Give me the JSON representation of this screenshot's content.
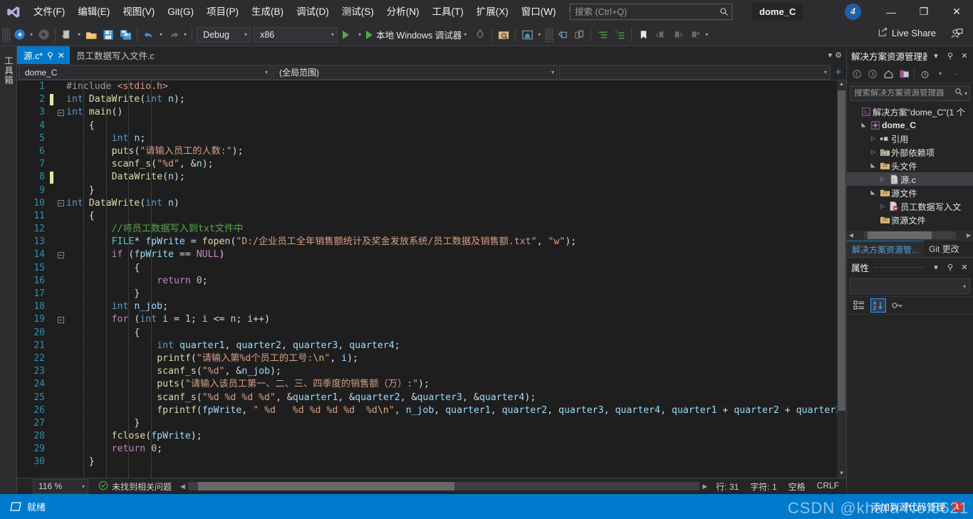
{
  "titlebar": {
    "logo_icon": "visual-studio-logo",
    "menus": [
      {
        "label": "文件(F)"
      },
      {
        "label": "编辑(E)"
      },
      {
        "label": "视图(V)"
      },
      {
        "label": "Git(G)"
      },
      {
        "label": "项目(P)"
      },
      {
        "label": "生成(B)"
      },
      {
        "label": "调试(D)"
      },
      {
        "label": "测试(S)"
      },
      {
        "label": "分析(N)"
      },
      {
        "label": "工具(T)"
      },
      {
        "label": "扩展(X)"
      },
      {
        "label": "窗口(W)"
      },
      {
        "label": "帮助(H)"
      }
    ],
    "search_placeholder": "搜索 (Ctrl+Q)",
    "search_value": "",
    "solution_name": "dome_C",
    "badge_count": "4",
    "minimize": "—",
    "restore": "❐",
    "close": "✕"
  },
  "toolbar": {
    "back_icon": "navigate-back-icon",
    "forward_icon": "navigate-forward-icon",
    "new_item_icon": "new-file-icon",
    "open_icon": "open-folder-icon",
    "save_icon": "save-icon",
    "save_all_icon": "save-all-icon",
    "undo_icon": "undo-icon",
    "redo_icon": "redo-icon",
    "config_value": "Debug",
    "platform_value": "x86",
    "start_label": "本地 Windows 调试器",
    "hot_reload_icon": "hot-reload-icon",
    "find_in_files_icon": "find-in-files-icon",
    "home_icon": "home-icon",
    "bookmark_icon": "bookmark-icon",
    "live_share_label": "Live Share",
    "account_icon": "account-icon"
  },
  "tabs": [
    {
      "label": "源.c*",
      "active": true,
      "pin_icon": "pin-icon",
      "close_icon": "close-icon"
    },
    {
      "label": "员工数据写入文件.c",
      "active": false
    }
  ],
  "navbar": {
    "project": "dome_C",
    "scope": "(全局范围)",
    "member": ""
  },
  "editor": {
    "lines": [
      {
        "n": "1",
        "changed": false,
        "fold": "",
        "indent": 0,
        "tokens": [
          {
            "t": "#include ",
            "c": "pp"
          },
          {
            "t": "<stdio.h>",
            "c": "st"
          }
        ]
      },
      {
        "n": "2",
        "changed": true,
        "fold": "",
        "indent": 0,
        "tokens": [
          {
            "t": "int",
            "c": "k"
          },
          {
            "t": " ",
            "c": "pn"
          },
          {
            "t": "DataWrite",
            "c": "fn"
          },
          {
            "t": "(",
            "c": "pn"
          },
          {
            "t": "int",
            "c": "k"
          },
          {
            "t": " n",
            "c": "id"
          },
          {
            "t": ");",
            "c": "pn"
          }
        ]
      },
      {
        "n": "3",
        "changed": false,
        "fold": "-",
        "indent": 0,
        "tokens": [
          {
            "t": "int",
            "c": "k"
          },
          {
            "t": " ",
            "c": "pn"
          },
          {
            "t": "main",
            "c": "fn"
          },
          {
            "t": "()",
            "c": "pn"
          }
        ]
      },
      {
        "n": "4",
        "changed": false,
        "fold": "",
        "indent": 1,
        "tokens": [
          {
            "t": "{",
            "c": "pn"
          }
        ]
      },
      {
        "n": "5",
        "changed": false,
        "fold": "",
        "indent": 2,
        "tokens": [
          {
            "t": "int",
            "c": "k"
          },
          {
            "t": " ",
            "c": "pn"
          },
          {
            "t": "n",
            "c": "id"
          },
          {
            "t": ";",
            "c": "pn"
          }
        ]
      },
      {
        "n": "6",
        "changed": false,
        "fold": "",
        "indent": 2,
        "tokens": [
          {
            "t": "puts",
            "c": "fn"
          },
          {
            "t": "(",
            "c": "pn"
          },
          {
            "t": "\"请输入员工的人数:\"",
            "c": "st"
          },
          {
            "t": ");",
            "c": "pn"
          }
        ]
      },
      {
        "n": "7",
        "changed": false,
        "fold": "",
        "indent": 2,
        "tokens": [
          {
            "t": "scanf_s",
            "c": "fn"
          },
          {
            "t": "(",
            "c": "pn"
          },
          {
            "t": "\"%d\"",
            "c": "st"
          },
          {
            "t": ", &",
            "c": "pn"
          },
          {
            "t": "n",
            "c": "id"
          },
          {
            "t": ");",
            "c": "pn"
          }
        ]
      },
      {
        "n": "8",
        "changed": true,
        "fold": "",
        "indent": 2,
        "tokens": [
          {
            "t": "DataWrite",
            "c": "fn"
          },
          {
            "t": "(",
            "c": "pn"
          },
          {
            "t": "n",
            "c": "id"
          },
          {
            "t": ");",
            "c": "pn"
          }
        ]
      },
      {
        "n": "9",
        "changed": false,
        "fold": "",
        "indent": 1,
        "tokens": [
          {
            "t": "}",
            "c": "pn"
          }
        ]
      },
      {
        "n": "10",
        "changed": false,
        "fold": "-",
        "indent": 0,
        "tokens": [
          {
            "t": "int",
            "c": "k"
          },
          {
            "t": " ",
            "c": "pn"
          },
          {
            "t": "DataWrite",
            "c": "fn"
          },
          {
            "t": "(",
            "c": "pn"
          },
          {
            "t": "int",
            "c": "k"
          },
          {
            "t": " n",
            "c": "id"
          },
          {
            "t": ")",
            "c": "pn"
          }
        ]
      },
      {
        "n": "11",
        "changed": false,
        "fold": "",
        "indent": 1,
        "tokens": [
          {
            "t": "{",
            "c": "pn"
          }
        ]
      },
      {
        "n": "12",
        "changed": false,
        "fold": "",
        "indent": 2,
        "tokens": [
          {
            "t": "//将员工数据写入到txt文件中",
            "c": "cm"
          }
        ]
      },
      {
        "n": "13",
        "changed": false,
        "fold": "",
        "indent": 2,
        "tokens": [
          {
            "t": "FILE",
            "c": "ty"
          },
          {
            "t": "* ",
            "c": "pn"
          },
          {
            "t": "fpWrite",
            "c": "id"
          },
          {
            "t": " = ",
            "c": "pn"
          },
          {
            "t": "fopen",
            "c": "fn"
          },
          {
            "t": "(",
            "c": "pn"
          },
          {
            "t": "\"D:/企业员工全年销售额统计及奖金发放系统/员工数据及销售额.txt\"",
            "c": "st"
          },
          {
            "t": ", ",
            "c": "pn"
          },
          {
            "t": "\"w\"",
            "c": "st"
          },
          {
            "t": ");",
            "c": "pn"
          }
        ]
      },
      {
        "n": "14",
        "changed": false,
        "fold": "-",
        "indent": 2,
        "tokens": [
          {
            "t": "if",
            "c": "kc"
          },
          {
            "t": " (",
            "c": "pn"
          },
          {
            "t": "fpWrite",
            "c": "id"
          },
          {
            "t": " == ",
            "c": "pn"
          },
          {
            "t": "NULL",
            "c": "kc"
          },
          {
            "t": ")",
            "c": "pn"
          }
        ]
      },
      {
        "n": "15",
        "changed": false,
        "fold": "",
        "indent": 3,
        "tokens": [
          {
            "t": "{",
            "c": "pn"
          }
        ]
      },
      {
        "n": "16",
        "changed": false,
        "fold": "",
        "indent": 4,
        "tokens": [
          {
            "t": "return",
            "c": "kc"
          },
          {
            "t": " ",
            "c": "pn"
          },
          {
            "t": "0",
            "c": "nu"
          },
          {
            "t": ";",
            "c": "pn"
          }
        ]
      },
      {
        "n": "17",
        "changed": false,
        "fold": "",
        "indent": 3,
        "tokens": [
          {
            "t": "}",
            "c": "pn"
          }
        ]
      },
      {
        "n": "18",
        "changed": false,
        "fold": "",
        "indent": 2,
        "tokens": [
          {
            "t": "int",
            "c": "k"
          },
          {
            "t": " ",
            "c": "pn"
          },
          {
            "t": "n_job",
            "c": "id"
          },
          {
            "t": ";",
            "c": "pn"
          }
        ]
      },
      {
        "n": "19",
        "changed": false,
        "fold": "-",
        "indent": 2,
        "tokens": [
          {
            "t": "for",
            "c": "kc"
          },
          {
            "t": " (",
            "c": "pn"
          },
          {
            "t": "int",
            "c": "k"
          },
          {
            "t": " ",
            "c": "pn"
          },
          {
            "t": "i",
            "c": "id"
          },
          {
            "t": " = ",
            "c": "pn"
          },
          {
            "t": "1",
            "c": "nu"
          },
          {
            "t": "; ",
            "c": "pn"
          },
          {
            "t": "i",
            "c": "id"
          },
          {
            "t": " <= ",
            "c": "pn"
          },
          {
            "t": "n",
            "c": "id"
          },
          {
            "t": "; ",
            "c": "pn"
          },
          {
            "t": "i",
            "c": "id"
          },
          {
            "t": "++)",
            "c": "pn"
          }
        ]
      },
      {
        "n": "20",
        "changed": false,
        "fold": "",
        "indent": 3,
        "tokens": [
          {
            "t": "{",
            "c": "pn"
          }
        ]
      },
      {
        "n": "21",
        "changed": false,
        "fold": "",
        "indent": 4,
        "tokens": [
          {
            "t": "int",
            "c": "k"
          },
          {
            "t": " ",
            "c": "pn"
          },
          {
            "t": "quarter1",
            "c": "id"
          },
          {
            "t": ", ",
            "c": "pn"
          },
          {
            "t": "quarter2",
            "c": "id"
          },
          {
            "t": ", ",
            "c": "pn"
          },
          {
            "t": "quarter3",
            "c": "id"
          },
          {
            "t": ", ",
            "c": "pn"
          },
          {
            "t": "quarter4",
            "c": "id"
          },
          {
            "t": ";",
            "c": "pn"
          }
        ]
      },
      {
        "n": "22",
        "changed": false,
        "fold": "",
        "indent": 4,
        "tokens": [
          {
            "t": "printf",
            "c": "fn"
          },
          {
            "t": "(",
            "c": "pn"
          },
          {
            "t": "\"请输入第%d个员工的工号:",
            "c": "st"
          },
          {
            "t": "\\n",
            "c": "esc"
          },
          {
            "t": "\"",
            "c": "st"
          },
          {
            "t": ", ",
            "c": "pn"
          },
          {
            "t": "i",
            "c": "id"
          },
          {
            "t": ");",
            "c": "pn"
          }
        ]
      },
      {
        "n": "23",
        "changed": false,
        "fold": "",
        "indent": 4,
        "tokens": [
          {
            "t": "scanf_s",
            "c": "fn"
          },
          {
            "t": "(",
            "c": "pn"
          },
          {
            "t": "\"%d\"",
            "c": "st"
          },
          {
            "t": ", &",
            "c": "pn"
          },
          {
            "t": "n_job",
            "c": "id"
          },
          {
            "t": ");",
            "c": "pn"
          }
        ]
      },
      {
        "n": "24",
        "changed": false,
        "fold": "",
        "indent": 4,
        "tokens": [
          {
            "t": "puts",
            "c": "fn"
          },
          {
            "t": "(",
            "c": "pn"
          },
          {
            "t": "\"请输入该员工第一、二、三、四季度的销售额（万）:\"",
            "c": "st"
          },
          {
            "t": ");",
            "c": "pn"
          }
        ]
      },
      {
        "n": "25",
        "changed": false,
        "fold": "",
        "indent": 4,
        "tokens": [
          {
            "t": "scanf_s",
            "c": "fn"
          },
          {
            "t": "(",
            "c": "pn"
          },
          {
            "t": "\"%d %d %d %d\"",
            "c": "st"
          },
          {
            "t": ", &",
            "c": "pn"
          },
          {
            "t": "quarter1",
            "c": "id"
          },
          {
            "t": ", &",
            "c": "pn"
          },
          {
            "t": "quarter2",
            "c": "id"
          },
          {
            "t": ", &",
            "c": "pn"
          },
          {
            "t": "quarter3",
            "c": "id"
          },
          {
            "t": ", &",
            "c": "pn"
          },
          {
            "t": "quarter4",
            "c": "id"
          },
          {
            "t": ");",
            "c": "pn"
          }
        ]
      },
      {
        "n": "26",
        "changed": false,
        "fold": "",
        "indent": 4,
        "tokens": [
          {
            "t": "fprintf",
            "c": "fn"
          },
          {
            "t": "(",
            "c": "pn"
          },
          {
            "t": "fpWrite",
            "c": "id"
          },
          {
            "t": ", ",
            "c": "pn"
          },
          {
            "t": "\" %d   %d %d %d %d  %d",
            "c": "st"
          },
          {
            "t": "\\n",
            "c": "esc"
          },
          {
            "t": "\"",
            "c": "st"
          },
          {
            "t": ", ",
            "c": "pn"
          },
          {
            "t": "n_job",
            "c": "id"
          },
          {
            "t": ", ",
            "c": "pn"
          },
          {
            "t": "quarter1",
            "c": "id"
          },
          {
            "t": ", ",
            "c": "pn"
          },
          {
            "t": "quarter2",
            "c": "id"
          },
          {
            "t": ", ",
            "c": "pn"
          },
          {
            "t": "quarter3",
            "c": "id"
          },
          {
            "t": ", ",
            "c": "pn"
          },
          {
            "t": "quarter4",
            "c": "id"
          },
          {
            "t": ", ",
            "c": "pn"
          },
          {
            "t": "quarter1",
            "c": "id"
          },
          {
            "t": " + ",
            "c": "pn"
          },
          {
            "t": "quarter2",
            "c": "id"
          },
          {
            "t": " + ",
            "c": "pn"
          },
          {
            "t": "quarter3",
            "c": "id"
          },
          {
            "t": " + ",
            "c": "pn"
          },
          {
            "t": "quarter",
            "c": "id"
          }
        ]
      },
      {
        "n": "27",
        "changed": false,
        "fold": "",
        "indent": 3,
        "tokens": [
          {
            "t": "}",
            "c": "pn"
          }
        ]
      },
      {
        "n": "28",
        "changed": false,
        "fold": "",
        "indent": 2,
        "tokens": [
          {
            "t": "fclose",
            "c": "fn"
          },
          {
            "t": "(",
            "c": "pn"
          },
          {
            "t": "fpWrite",
            "c": "id"
          },
          {
            "t": ");",
            "c": "pn"
          }
        ]
      },
      {
        "n": "29",
        "changed": false,
        "fold": "",
        "indent": 2,
        "tokens": [
          {
            "t": "return",
            "c": "kc"
          },
          {
            "t": " ",
            "c": "pn"
          },
          {
            "t": "0",
            "c": "nu"
          },
          {
            "t": ";",
            "c": "pn"
          }
        ]
      },
      {
        "n": "30",
        "changed": false,
        "fold": "",
        "indent": 1,
        "tokens": [
          {
            "t": "}",
            "c": "pn"
          }
        ]
      }
    ]
  },
  "editor_status": {
    "zoom": "116 %",
    "issues_icon": "check-circle-icon",
    "issues_text": "未找到相关问题",
    "line_label": "行: 31",
    "char_label": "字符: 1",
    "spaces_label": "空格",
    "eol_label": "CRLF"
  },
  "solution_explorer": {
    "title": "解决方案资源管理器",
    "dropdown_icon": "chevron-down-icon",
    "pin_icon": "pin-icon",
    "close_icon": "close-icon",
    "toolbar_icons": [
      "back-icon",
      "forward-icon",
      "home-icon",
      "switch-views-icon",
      "pending-changes-icon"
    ],
    "search_placeholder": "搜索解决方案资源管理器",
    "search_value": "",
    "tree": [
      {
        "depth": 0,
        "arrow": "",
        "icon": "solution-icon",
        "label": "解决方案\"dome_C\"(1 个",
        "bold": false,
        "selected": false
      },
      {
        "depth": 1,
        "arrow": "▲",
        "icon": "project-icon",
        "label": "dome_C",
        "bold": true,
        "selected": false
      },
      {
        "depth": 2,
        "arrow": "▷",
        "icon": "references-icon",
        "label": "引用",
        "bold": false,
        "selected": false
      },
      {
        "depth": 2,
        "arrow": "▷",
        "icon": "ext-deps-icon",
        "label": "外部依赖项",
        "bold": false,
        "selected": false
      },
      {
        "depth": 2,
        "arrow": "▲",
        "icon": "folder-icon",
        "label": "头文件",
        "bold": false,
        "selected": false
      },
      {
        "depth": 3,
        "arrow": "▷",
        "icon": "c-file-icon",
        "label": "源.c",
        "bold": false,
        "selected": true
      },
      {
        "depth": 2,
        "arrow": "▲",
        "icon": "folder-icon",
        "label": "源文件",
        "bold": false,
        "selected": false
      },
      {
        "depth": 3,
        "arrow": "▷",
        "icon": "c-file-error-icon",
        "label": "员工数据写入文",
        "bold": false,
        "selected": false
      },
      {
        "depth": 2,
        "arrow": "",
        "icon": "folder-icon",
        "label": "资源文件",
        "bold": false,
        "selected": false
      }
    ],
    "dock_tabs": [
      {
        "label": "解决方案资源管...",
        "active": true
      },
      {
        "label": "Git 更改",
        "active": false
      }
    ]
  },
  "properties": {
    "title": "属性",
    "dropdown_icon": "chevron-down-icon",
    "pin_icon": "pin-icon",
    "close_icon": "close-icon",
    "categorized_icon": "categorized-icon",
    "alphabetical_icon": "alphabetical-sort-icon",
    "property_pages_icon": "property-pages-icon"
  },
  "statusbar": {
    "icon": "ready-icon",
    "status_text": "就绪",
    "source_control_text": "添加到源代码管理",
    "notification_count": "1",
    "watermark": "CSDN @khara No.8621",
    "accent_color": "#007acc"
  }
}
